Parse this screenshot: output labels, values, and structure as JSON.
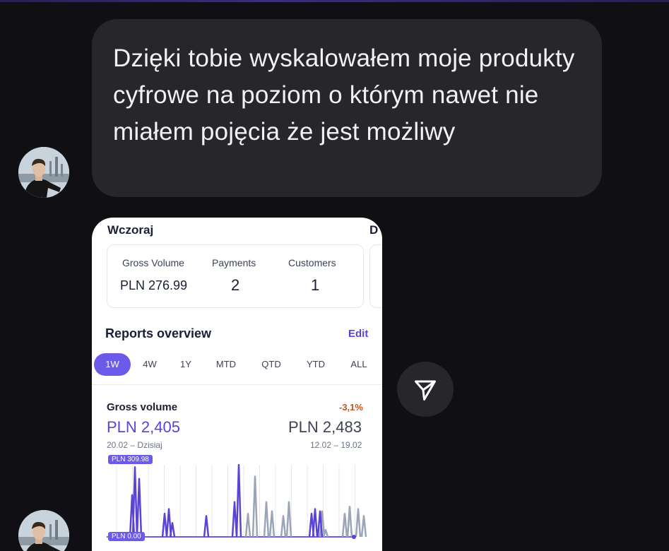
{
  "message": {
    "text": "Dzięki tobie wyskalowałem moje produkty cyfrowe na poziom o którym nawet nie miałem pojęcia że jest możliwy"
  },
  "shared_screenshot": {
    "section_title": "Wczoraj",
    "section_title_next": "D",
    "stats": [
      {
        "label": "Gross Volume",
        "value": "PLN 276.99"
      },
      {
        "label": "Payments",
        "value": "2"
      },
      {
        "label": "Customers",
        "value": "1"
      }
    ],
    "reports_title": "Reports overview",
    "edit_label": "Edit",
    "ranges": [
      "1W",
      "4W",
      "1Y",
      "MTD",
      "QTD",
      "YTD",
      "ALL"
    ],
    "active_range": "1W",
    "gross_volume": {
      "label": "Gross volume",
      "change": "-3,1%",
      "current": "PLN 2,405",
      "previous": "PLN 2,483",
      "current_range": "20.02 – Dzisiaj",
      "previous_range": "12.02 – 19.02"
    }
  },
  "chart_data": {
    "type": "line",
    "ylim": [
      0,
      309.98
    ],
    "y_max_label": "PLN 309.98",
    "y_min_label": "PLN 0.00",
    "series": [
      {
        "color": "#5b43d6",
        "values": [
          0,
          0,
          0,
          0,
          0,
          0,
          0,
          0,
          0,
          0,
          0,
          0,
          310,
          0,
          0,
          0,
          260,
          0,
          0,
          0,
          0,
          0,
          0,
          0,
          0,
          0,
          0,
          0,
          0,
          0,
          0,
          0,
          0,
          0,
          0,
          120,
          0,
          140,
          0,
          0,
          0,
          0,
          0,
          0,
          0,
          90,
          0,
          0,
          0,
          0,
          0,
          0,
          0,
          0,
          0,
          0,
          0,
          0,
          0,
          0,
          0,
          0,
          0,
          0,
          0,
          0,
          0,
          0,
          0,
          0,
          0,
          0,
          0,
          0,
          0,
          0,
          0,
          0,
          0,
          0,
          0,
          0,
          0,
          0,
          0,
          0,
          0,
          0,
          0,
          0,
          0,
          0,
          0,
          0,
          0,
          110,
          0,
          0,
          0,
          0,
          0,
          0,
          0,
          0,
          0,
          0,
          0,
          0,
          0,
          0,
          0,
          0,
          0,
          0,
          0,
          0,
          0,
          0,
          0,
          0,
          0,
          0,
          0,
          0,
          0,
          0,
          0,
          0,
          0,
          0,
          0,
          0,
          0,
          0,
          0,
          0,
          0,
          0,
          0,
          0,
          0,
          0,
          0,
          0,
          0,
          0,
          0,
          0,
          0,
          0,
          0,
          0,
          0,
          0,
          0,
          0,
          0,
          0,
          0,
          0,
          0,
          0,
          0,
          0,
          0,
          0,
          0,
          0,
          0,
          0,
          0,
          0,
          0,
          0,
          0,
          0,
          0,
          0,
          0,
          0,
          0,
          0,
          0,
          0,
          0,
          0,
          0,
          0,
          0,
          0,
          0,
          0,
          0,
          0,
          0,
          0,
          0,
          0,
          0,
          0,
          0,
          0,
          0,
          0,
          0,
          0,
          0,
          0,
          0,
          0,
          0,
          0,
          0,
          0,
          0,
          0,
          0,
          0,
          0,
          0,
          0,
          0,
          0,
          0,
          0,
          0,
          0,
          0,
          0,
          0,
          0,
          0,
          0,
          0,
          0,
          0,
          0,
          0,
          0,
          0,
          0,
          0,
          0,
          0,
          0,
          0
        ]
      },
      {
        "color": "#5b43d6",
        "values": [
          0,
          0,
          0,
          0,
          0,
          0,
          0,
          0,
          0,
          0,
          0,
          0,
          0,
          0,
          0,
          0,
          0,
          0,
          0,
          0,
          0,
          0,
          0,
          0,
          0,
          0,
          0,
          0,
          0,
          0,
          0,
          0,
          0,
          0,
          0,
          0,
          0,
          0,
          0,
          0,
          0,
          0,
          0,
          0,
          0,
          0,
          0,
          0,
          0,
          0,
          0,
          0,
          0,
          0,
          0,
          0,
          0,
          0,
          0,
          0,
          0,
          0,
          0,
          0,
          0,
          0,
          0,
          0,
          0,
          0,
          0,
          0,
          0,
          0,
          0,
          0,
          0,
          0,
          0,
          0,
          0,
          0,
          0,
          0,
          0,
          0,
          0,
          0,
          0,
          0,
          0,
          0,
          0,
          0,
          0,
          0,
          0,
          0,
          0,
          0,
          0,
          0,
          0,
          0,
          0,
          0,
          0,
          0,
          0,
          0,
          0,
          0,
          0,
          0,
          0,
          0,
          0,
          0,
          0,
          0,
          0,
          0,
          0,
          0,
          0,
          0,
          0,
          0,
          0,
          0,
          0,
          0,
          0,
          0,
          0,
          0,
          0,
          0,
          0,
          0,
          0,
          0,
          0,
          0,
          0,
          0,
          0,
          0,
          0,
          0,
          0,
          0,
          0,
          0,
          0,
          0,
          0,
          0,
          0,
          0,
          0,
          0,
          0,
          0,
          0,
          0,
          0,
          0,
          0,
          0,
          0,
          0,
          0,
          0,
          0,
          0,
          0,
          0,
          0,
          0,
          0,
          0,
          0,
          0,
          0,
          0,
          0,
          0,
          0,
          0,
          0,
          0,
          0,
          0,
          0,
          0,
          0,
          0,
          0,
          0,
          0,
          0,
          0,
          0,
          0,
          0,
          0,
          0,
          0,
          0,
          0,
          0,
          0,
          0,
          0,
          0,
          0,
          0,
          0,
          0,
          0,
          0,
          0,
          0,
          0,
          0,
          0,
          0,
          0,
          0,
          0,
          0,
          0,
          0,
          0,
          0,
          0,
          0,
          0,
          0,
          0,
          0,
          0,
          0,
          0,
          0,
          0,
          0,
          0,
          0
        ]
      }
    ]
  },
  "colors": {
    "background": "#0f0f14",
    "bubble": "#26262b",
    "accent": "#5b43d6",
    "negative": "#c4551b",
    "prev_series": "#9aa5b8"
  }
}
